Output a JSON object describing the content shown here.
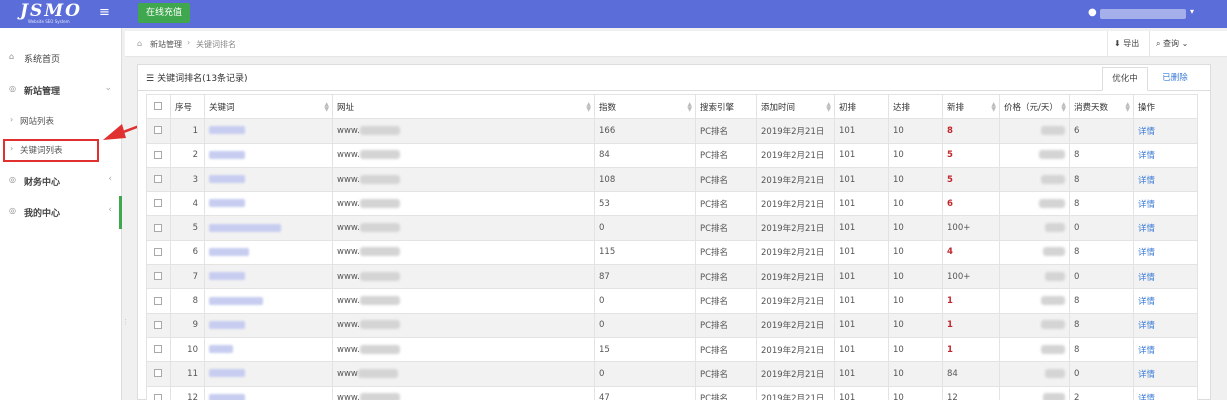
{
  "colors": {
    "topbar": "#5b6dd8",
    "accent_green": "#3fa84e",
    "highlight_red": "#e03030",
    "link_blue": "#3b7bd6",
    "rank_red": "#c0272d"
  },
  "header": {
    "logo_text": "JSMO",
    "logo_sub": "Website SEO System",
    "menu_icon": "hamburger-icon",
    "recharge_label": "在线充值",
    "user_icon": "user-icon"
  },
  "sidebar": {
    "items": [
      {
        "label": "系统首页",
        "icon": "home-icon"
      },
      {
        "label": "新站管理",
        "icon": "circle-icon"
      },
      {
        "label": "网站列表"
      },
      {
        "label": "关键词列表"
      },
      {
        "label": "财务中心",
        "icon": "circle-icon"
      },
      {
        "label": "我的中心",
        "icon": "circle-icon"
      }
    ]
  },
  "breadcrumb": {
    "level1": "新站管理",
    "level2": "关键词排名"
  },
  "toolbar": {
    "export_label": "导出",
    "query_label": "查询"
  },
  "panel": {
    "title": "关键词排名(13条记录)",
    "tabs": [
      {
        "label": "优化中",
        "active": true
      },
      {
        "label": "已删除",
        "active": false
      }
    ]
  },
  "table": {
    "headers": [
      "",
      "序号",
      "关键词",
      "网址",
      "指数",
      "搜索引擎",
      "添加时间",
      "初排",
      "达排",
      "新排",
      "价格（元/天）",
      "消费天数",
      "操作"
    ],
    "rows": [
      {
        "no": "1",
        "url": "www.",
        "index": "166",
        "engine": "PC排名",
        "date": "2019年2月21日",
        "initial": "101",
        "target": "10",
        "new": "8",
        "days": "6",
        "action": "详情"
      },
      {
        "no": "2",
        "url": "www.",
        "index": "84",
        "engine": "PC排名",
        "date": "2019年2月21日",
        "initial": "101",
        "target": "10",
        "new": "5",
        "days": "8",
        "action": "详情"
      },
      {
        "no": "3",
        "url": "www.",
        "index": "108",
        "engine": "PC排名",
        "date": "2019年2月21日",
        "initial": "101",
        "target": "10",
        "new": "5",
        "days": "8",
        "action": "详情"
      },
      {
        "no": "4",
        "url": "www.",
        "index": "53",
        "engine": "PC排名",
        "date": "2019年2月21日",
        "initial": "101",
        "target": "10",
        "new": "6",
        "days": "8",
        "action": "详情"
      },
      {
        "no": "5",
        "url": "www.",
        "index": "0",
        "engine": "PC排名",
        "date": "2019年2月21日",
        "initial": "101",
        "target": "10",
        "new": "100+",
        "days": "0",
        "action": "详情"
      },
      {
        "no": "6",
        "url": "www.",
        "index": "115",
        "engine": "PC排名",
        "date": "2019年2月21日",
        "initial": "101",
        "target": "10",
        "new": "4",
        "days": "8",
        "action": "详情"
      },
      {
        "no": "7",
        "url": "www.",
        "index": "87",
        "engine": "PC排名",
        "date": "2019年2月21日",
        "initial": "101",
        "target": "10",
        "new": "100+",
        "days": "0",
        "action": "详情"
      },
      {
        "no": "8",
        "url": "www.",
        "index": "0",
        "engine": "PC排名",
        "date": "2019年2月21日",
        "initial": "101",
        "target": "10",
        "new": "1",
        "days": "8",
        "action": "详情"
      },
      {
        "no": "9",
        "url": "www.",
        "index": "0",
        "engine": "PC排名",
        "date": "2019年2月21日",
        "initial": "101",
        "target": "10",
        "new": "1",
        "days": "8",
        "action": "详情"
      },
      {
        "no": "10",
        "url": "www.",
        "index": "15",
        "engine": "PC排名",
        "date": "2019年2月21日",
        "initial": "101",
        "target": "10",
        "new": "1",
        "days": "8",
        "action": "详情"
      },
      {
        "no": "11",
        "url": "www",
        "index": "0",
        "engine": "PC排名",
        "date": "2019年2月21日",
        "initial": "101",
        "target": "10",
        "new": "84",
        "days": "0",
        "action": "详情"
      },
      {
        "no": "12",
        "url": "www.",
        "index": "47",
        "engine": "PC排名",
        "date": "2019年2月21日",
        "initial": "101",
        "target": "10",
        "new": "12",
        "days": "2",
        "action": "详情"
      }
    ]
  }
}
